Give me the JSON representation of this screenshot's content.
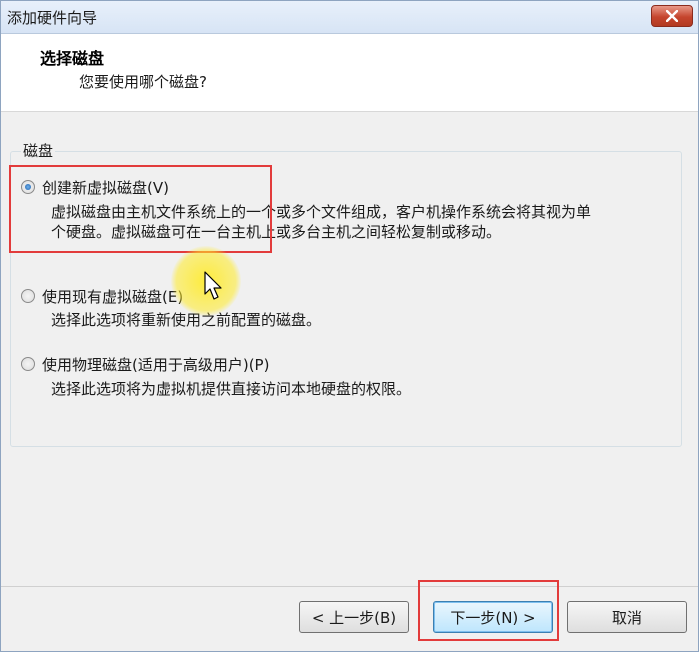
{
  "window": {
    "title": "添加硬件向导"
  },
  "header": {
    "title": "选择磁盘",
    "subtitle": "您要使用哪个磁盘?"
  },
  "group": {
    "label": "磁盘"
  },
  "options": [
    {
      "label": "创建新虚拟磁盘(V)",
      "checked": true,
      "description_line1": "虚拟磁盘由主机文件系统上的一个或多个文件组成，客户机操作系统会将其视为单",
      "description_line2": "个硬盘。虚拟磁盘可在一台主机上或多台主机之间轻松复制或移动。"
    },
    {
      "label": "使用现有虚拟磁盘(E)",
      "checked": false,
      "description_line1": "选择此选项将重新使用之前配置的磁盘。"
    },
    {
      "label": "使用物理磁盘(适用于高级用户)(P)",
      "checked": false,
      "description_line1": "选择此选项将为虚拟机提供直接访问本地硬盘的权限。"
    }
  ],
  "buttons": {
    "back": "< 上一步(B)",
    "next": "下一步(N) >",
    "cancel": "取消"
  },
  "icons": {
    "close": "close-icon",
    "cursor": "mouse-pointer-icon"
  },
  "colors": {
    "highlight": "#e23b3b",
    "cursor_glow": "#ffeb28"
  }
}
